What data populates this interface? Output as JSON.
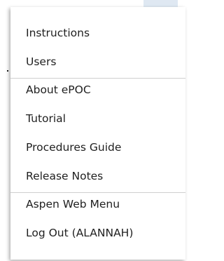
{
  "menu": {
    "groups": [
      {
        "items": [
          {
            "label": "Instructions"
          },
          {
            "label": "Users"
          }
        ]
      },
      {
        "items": [
          {
            "label": "About ePOC"
          },
          {
            "label": "Tutorial"
          },
          {
            "label": "Procedures Guide"
          },
          {
            "label": "Release Notes"
          }
        ]
      },
      {
        "items": [
          {
            "label": "Aspen Web Menu"
          },
          {
            "label": "Log Out (ALANNAH)"
          }
        ]
      }
    ]
  },
  "colors": {
    "text": "#1f1f1f",
    "divider": "#cfcfcf",
    "background": "#ffffff"
  }
}
